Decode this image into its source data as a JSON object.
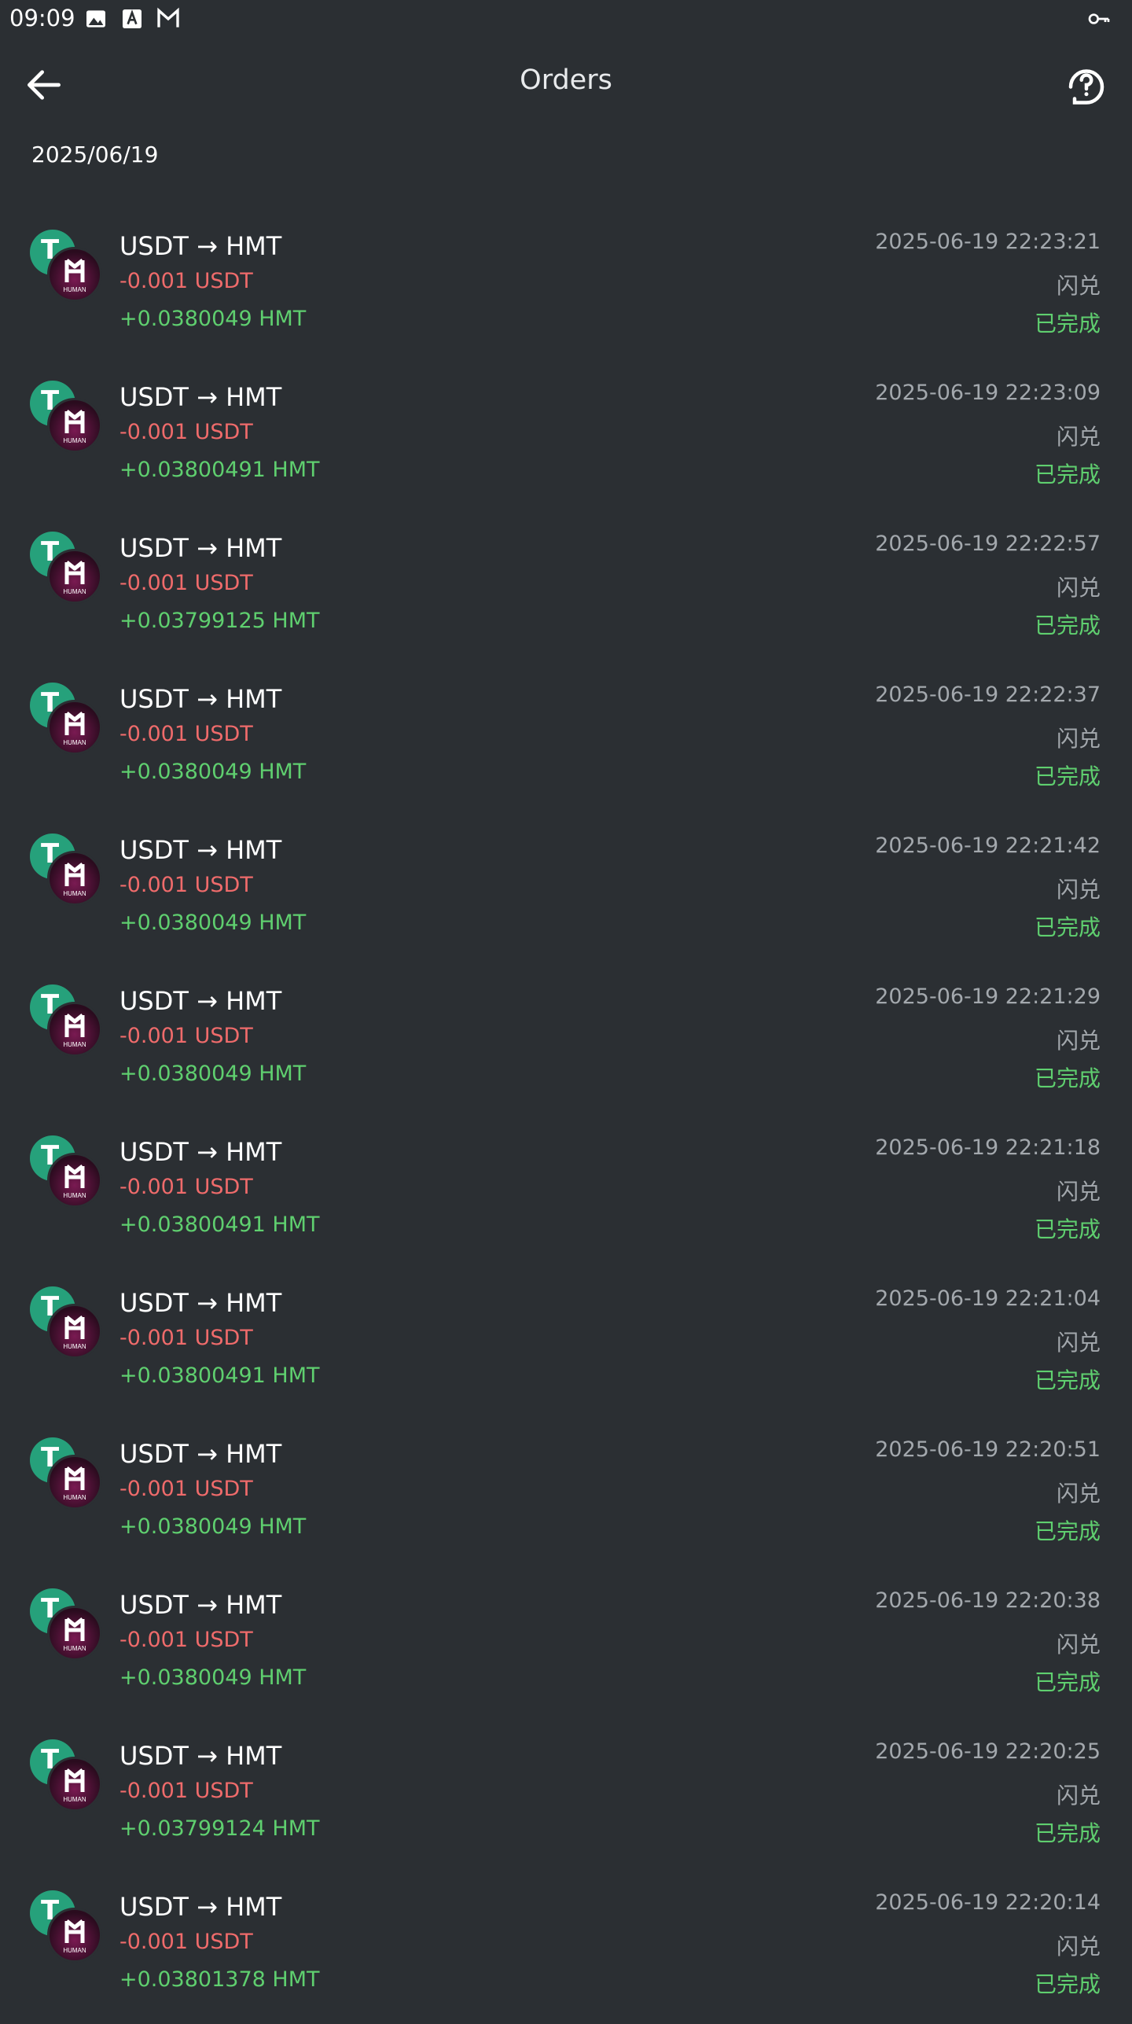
{
  "status_bar": {
    "time": "09:09",
    "icons": [
      "image-icon",
      "font-icon",
      "mail-icon",
      "key-icon"
    ]
  },
  "app_bar": {
    "title": "Orders",
    "back_icon": "arrow-left-icon",
    "help_icon": "support-question-icon"
  },
  "date_header": "2025/06/19",
  "colors": {
    "background": "#2b2f33",
    "debit": "#ef6b6b",
    "credit": "#5fcf6f",
    "muted": "#a3a8ad",
    "usdt": "#26a17b",
    "hmt": "#7a1a52"
  },
  "coin_icons": {
    "usdt_symbol": "T",
    "hmt_symbol": "H",
    "hmt_label": "HUMAN"
  },
  "orders": [
    {
      "pair": "USDT → HMT",
      "debit": "-0.001 USDT",
      "credit": "+0.0380049 HMT",
      "datetime": "2025-06-19 22:23:21",
      "type": "闪兑",
      "status": "已完成"
    },
    {
      "pair": "USDT → HMT",
      "debit": "-0.001 USDT",
      "credit": "+0.03800491 HMT",
      "datetime": "2025-06-19 22:23:09",
      "type": "闪兑",
      "status": "已完成"
    },
    {
      "pair": "USDT → HMT",
      "debit": "-0.001 USDT",
      "credit": "+0.03799125 HMT",
      "datetime": "2025-06-19 22:22:57",
      "type": "闪兑",
      "status": "已完成"
    },
    {
      "pair": "USDT → HMT",
      "debit": "-0.001 USDT",
      "credit": "+0.0380049 HMT",
      "datetime": "2025-06-19 22:22:37",
      "type": "闪兑",
      "status": "已完成"
    },
    {
      "pair": "USDT → HMT",
      "debit": "-0.001 USDT",
      "credit": "+0.0380049 HMT",
      "datetime": "2025-06-19 22:21:42",
      "type": "闪兑",
      "status": "已完成"
    },
    {
      "pair": "USDT → HMT",
      "debit": "-0.001 USDT",
      "credit": "+0.0380049 HMT",
      "datetime": "2025-06-19 22:21:29",
      "type": "闪兑",
      "status": "已完成"
    },
    {
      "pair": "USDT → HMT",
      "debit": "-0.001 USDT",
      "credit": "+0.03800491 HMT",
      "datetime": "2025-06-19 22:21:18",
      "type": "闪兑",
      "status": "已完成"
    },
    {
      "pair": "USDT → HMT",
      "debit": "-0.001 USDT",
      "credit": "+0.03800491 HMT",
      "datetime": "2025-06-19 22:21:04",
      "type": "闪兑",
      "status": "已完成"
    },
    {
      "pair": "USDT → HMT",
      "debit": "-0.001 USDT",
      "credit": "+0.0380049 HMT",
      "datetime": "2025-06-19 22:20:51",
      "type": "闪兑",
      "status": "已完成"
    },
    {
      "pair": "USDT → HMT",
      "debit": "-0.001 USDT",
      "credit": "+0.0380049 HMT",
      "datetime": "2025-06-19 22:20:38",
      "type": "闪兑",
      "status": "已完成"
    },
    {
      "pair": "USDT → HMT",
      "debit": "-0.001 USDT",
      "credit": "+0.03799124 HMT",
      "datetime": "2025-06-19 22:20:25",
      "type": "闪兑",
      "status": "已完成"
    },
    {
      "pair": "USDT → HMT",
      "debit": "-0.001 USDT",
      "credit": "+0.03801378 HMT",
      "datetime": "2025-06-19 22:20:14",
      "type": "闪兑",
      "status": "已完成"
    }
  ]
}
